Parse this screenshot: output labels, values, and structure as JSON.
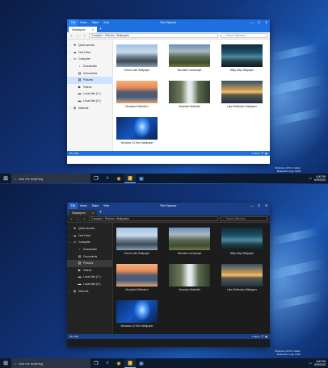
{
  "window": {
    "title": "File Explorer",
    "ribbon_tabs": [
      "File",
      "Home",
      "Share",
      "View"
    ],
    "controls": {
      "minimize": "—",
      "maximize": "☐",
      "close": "✕"
    },
    "doc_tab": {
      "label": "Wallpapers",
      "close": "×"
    },
    "new_tab": "+",
    "breadcrumb": "Computer › Pictures › Wallpapers",
    "search_placeholder": "Search Windows",
    "nav": {
      "back": "‹",
      "forward": "›",
      "up": "↑"
    },
    "status_left": "67.2 KB",
    "status_right": "7 items"
  },
  "sidebar": [
    {
      "label": "Quick access",
      "icon": "star-icon",
      "glyph": "★",
      "chev": "›",
      "indent": 0
    },
    {
      "label": "One Drive",
      "icon": "cloud-icon",
      "glyph": "☁",
      "chev": "›",
      "indent": 0
    },
    {
      "label": "Computer",
      "icon": "computer-icon",
      "glyph": "▭",
      "chev": "⌄",
      "indent": 0
    },
    {
      "label": "Downloads",
      "icon": "download-icon",
      "glyph": "↓",
      "chev": "",
      "indent": 1
    },
    {
      "label": "Documents",
      "icon": "document-icon",
      "glyph": "▤",
      "chev": "",
      "indent": 1
    },
    {
      "label": "Pictures",
      "icon": "picture-icon",
      "glyph": "▨",
      "chev": "",
      "indent": 1,
      "selected": true
    },
    {
      "label": "Videos",
      "icon": "video-icon",
      "glyph": "▶",
      "chev": "",
      "indent": 1
    },
    {
      "label": "Local disk (C:)",
      "icon": "disk-icon",
      "glyph": "▬",
      "chev": "",
      "indent": 1
    },
    {
      "label": "Local disk (D:)",
      "icon": "disk-icon",
      "glyph": "▬",
      "chev": "",
      "indent": 1
    },
    {
      "label": "Network",
      "icon": "network-icon",
      "glyph": "◍",
      "chev": "›",
      "indent": 0
    }
  ],
  "files": [
    {
      "name": "Eckoh Lake Wallpaper",
      "style": "antelope"
    },
    {
      "name": "Mountain Landscape",
      "style": "landscape"
    },
    {
      "name": "Milky Way Wallpaper",
      "style": "milkyway"
    },
    {
      "name": "Mountain Reflection",
      "style": "reflection"
    },
    {
      "name": "Mountain Waterfall",
      "style": "waterfall"
    },
    {
      "name": "Lake Reflection Wallpaper",
      "style": "lakeref"
    },
    {
      "name": "Windows 10 Hero Wallpaper",
      "style": "hero"
    }
  ],
  "taskbar": {
    "start": "⊞",
    "search_placeholder": "Ask me anything",
    "apps": [
      {
        "name": "task-view-icon",
        "glyph": "❐",
        "color": "#ffffff"
      },
      {
        "name": "edge-icon",
        "glyph": "e",
        "color": "#3aa0ff"
      },
      {
        "name": "chrome-icon",
        "glyph": "◉",
        "color": "#f2c12e"
      },
      {
        "name": "file-explorer-icon",
        "glyph": "▆",
        "color": "#f0c040",
        "active": true
      },
      {
        "name": "store-icon",
        "glyph": "▣",
        "color": "#6fb4ff"
      }
    ],
    "time": "4:00 PM",
    "date": "6/29/2015"
  },
  "watermark": {
    "line1": "Windows 10 Pro Insider",
    "line2": "Evaluation copy. Build"
  }
}
